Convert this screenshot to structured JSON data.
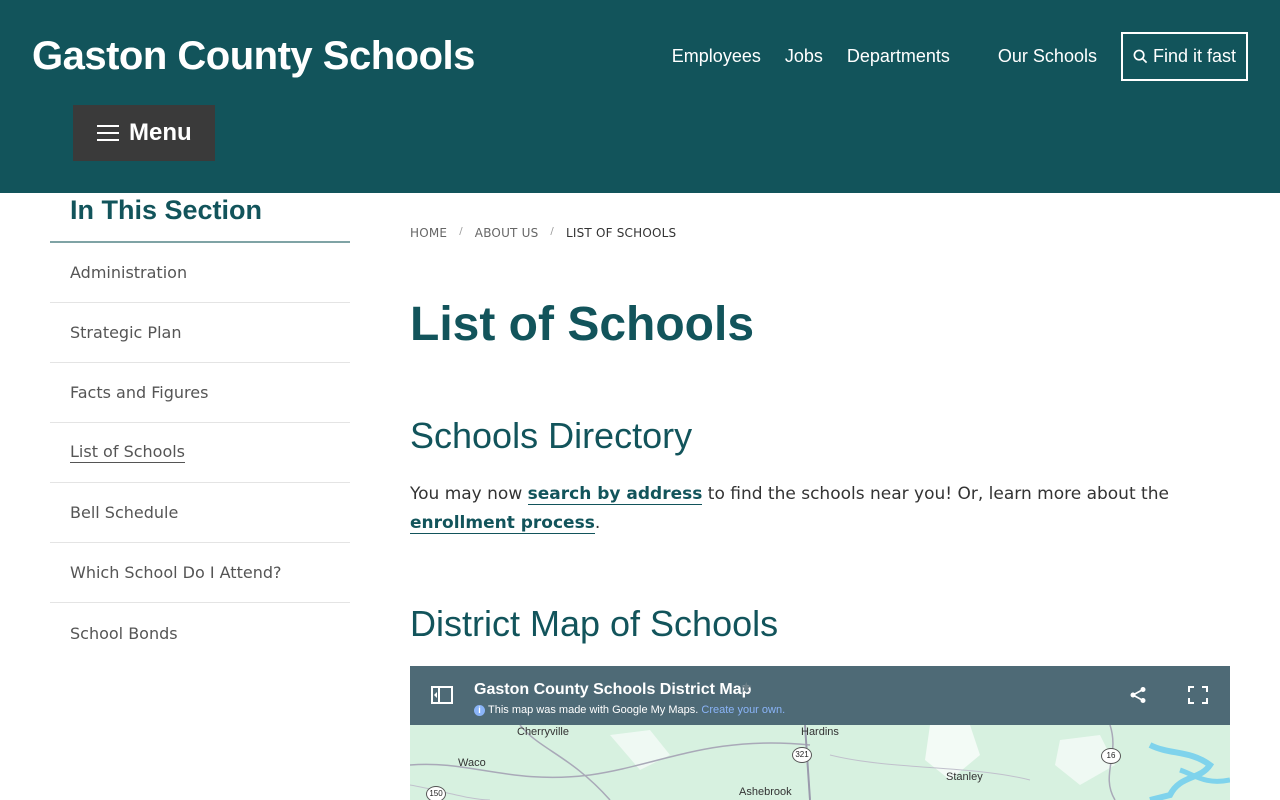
{
  "header": {
    "site_title": "Gaston County Schools",
    "nav": [
      "Employees",
      "Jobs",
      "Departments",
      "Our Schools"
    ],
    "find_label": "Find it fast",
    "menu_label": "Menu"
  },
  "sidebar": {
    "heading": "In This Section",
    "items": [
      {
        "label": "Administration"
      },
      {
        "label": "Strategic Plan"
      },
      {
        "label": "Facts and Figures"
      },
      {
        "label": "List of Schools"
      },
      {
        "label": "Bell Schedule"
      },
      {
        "label": "Which School Do I Attend?"
      },
      {
        "label": "School Bonds"
      }
    ]
  },
  "breadcrumb": {
    "items": [
      "HOME",
      "ABOUT US",
      "LIST OF SCHOOLS"
    ],
    "separator": "/"
  },
  "main": {
    "title": "List of Schools",
    "directory_heading": "Schools Directory",
    "intro_before": "You may now ",
    "link_search": "search by address",
    "intro_middle": " to find the schools near you! Or, learn more about the ",
    "link_enrollment": "enrollment process",
    "intro_after": ".",
    "map_heading": "District Map of Schools"
  },
  "map": {
    "title": "Gaston County Schools District Map",
    "notice": "This map was made with Google My Maps.",
    "create_link": "Create your own.",
    "info_glyph": "i",
    "star_glyph": "★",
    "towns": [
      "Cherryville",
      "Hardins",
      "Waco",
      "Stanley",
      "Ashebrook"
    ],
    "route_shields": [
      "321",
      "16",
      "150"
    ]
  },
  "colors": {
    "header_bg": "#12545b",
    "accent": "#12545b",
    "menu_bg": "#3a3a3a",
    "map_bar": "#4e6a76"
  }
}
